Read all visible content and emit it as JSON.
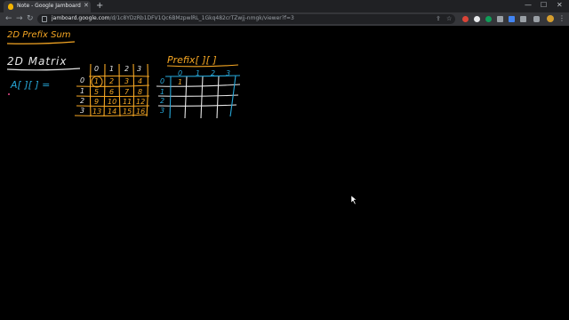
{
  "browser": {
    "tab_title": "Note - Google Jamboard",
    "url_host": "jamboard.google.com",
    "url_path": "/d/1c8YDzRb1DFV1Qc6BMzpwlRL_1Gkq482crTZwjj-nmgk/viewer?f=3"
  },
  "board": {
    "title_note": "2D Prefix Sum",
    "matrix_heading": "2D Matrix",
    "a_label": "A[ ][ ] =",
    "prefix_label": "Prefix[ ][ ]",
    "col_headers": [
      "0",
      "1",
      "2",
      "3"
    ],
    "row_headers": [
      "0",
      "1",
      "2",
      "3"
    ],
    "a_values": [
      [
        "1",
        "2",
        "3",
        "4"
      ],
      [
        "5",
        "6",
        "7",
        "8"
      ],
      [
        "9",
        "10",
        "11",
        "12"
      ],
      [
        "13",
        "14",
        "15",
        "16"
      ]
    ],
    "prefix_top_left": "1",
    "colors": {
      "white": "#e6e6e6",
      "orange": "#f5a623",
      "blue": "#27a7d8",
      "background": "#000000"
    }
  }
}
